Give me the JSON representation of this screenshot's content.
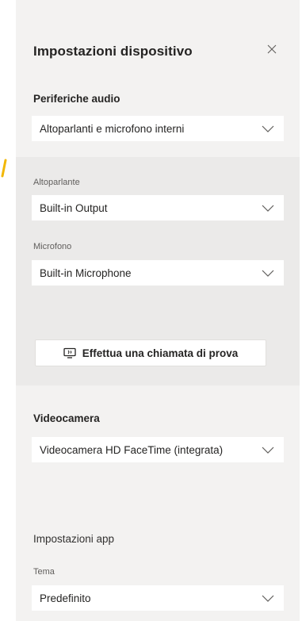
{
  "panel": {
    "title": "Impostazioni dispositivo",
    "close_icon": "close-icon"
  },
  "audio": {
    "section_label": "Periferiche audio",
    "device_value": "Altoparlanti e microfono interni",
    "speaker_label": "Altoparlante",
    "speaker_value": "Built-in Output",
    "mic_label": "Microfono",
    "mic_value": "Built-in Microphone",
    "test_call_label": "Effettua una chiamata di prova",
    "test_call_icon": "test-call-icon"
  },
  "camera": {
    "section_label": "Videocamera",
    "value": "Videocamera HD FaceTime (integrata)"
  },
  "app_settings": {
    "section_label": "Impostazioni app",
    "theme_label": "Tema",
    "theme_value": "Predefinito"
  },
  "colors": {
    "panel_background": "#f3f2f1",
    "band_background": "#ebeae9",
    "edge_mark": "#f2b705"
  }
}
